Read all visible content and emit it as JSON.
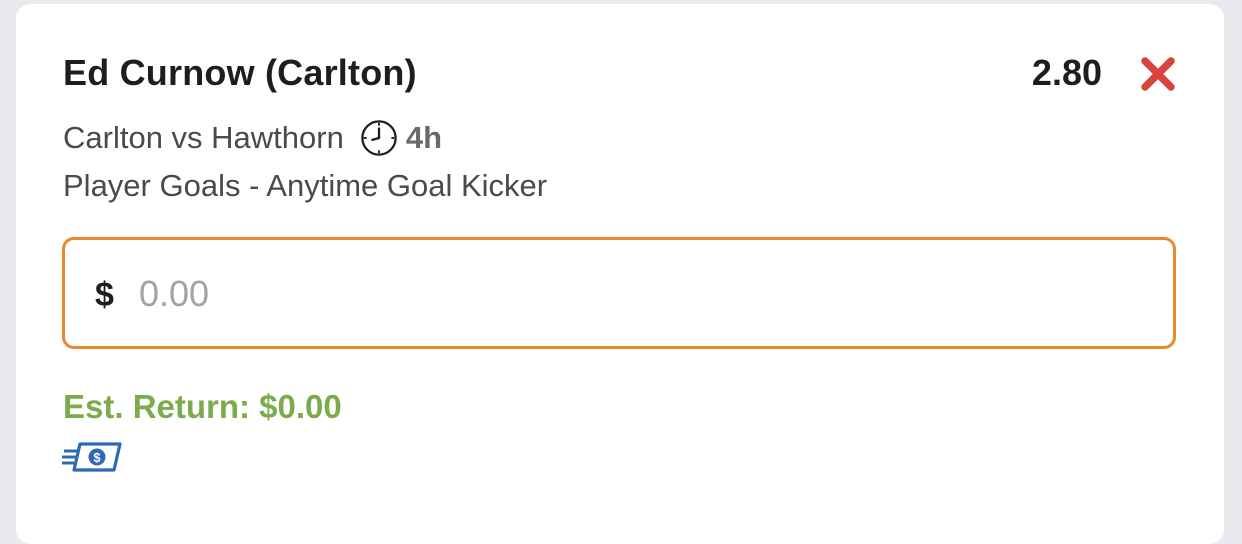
{
  "bet": {
    "selection": "Ed Curnow (Carlton)",
    "odds": "2.80",
    "match": "Carlton vs Hawthorn",
    "time_to_start": "4h",
    "market": "Player Goals - Anytime Goal Kicker"
  },
  "stake": {
    "currency_symbol": "$",
    "placeholder": "0.00",
    "value": ""
  },
  "est_return": "Est. Return: $0.00",
  "icons": {
    "remove": "close-x-icon",
    "clock": "clock-icon",
    "cash": "fast-cash-icon"
  },
  "colors": {
    "remove": "#d9433b",
    "input_border": "#e8882f",
    "est_return": "#7cab4c",
    "cash_icon": "#2f69b3"
  }
}
